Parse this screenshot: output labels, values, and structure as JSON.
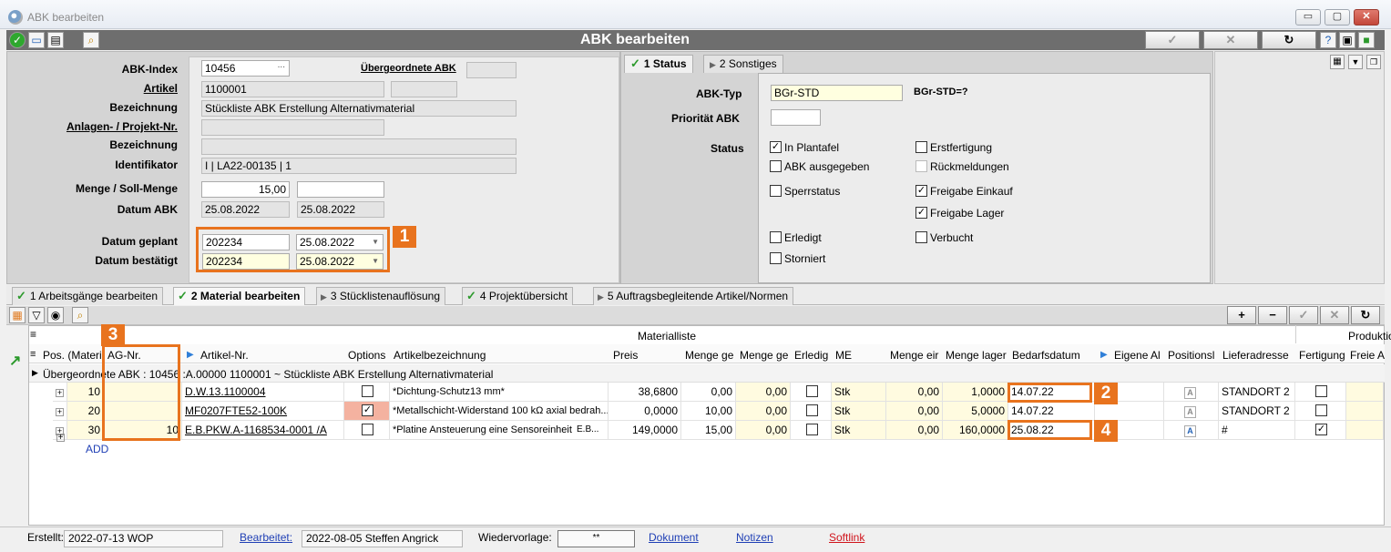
{
  "window": {
    "title": "ABK bearbeiten",
    "min": "▭",
    "max": "▢",
    "close": "✕"
  },
  "header": {
    "title": "ABK bearbeiten",
    "btn_ok": "✓",
    "btn_cancel": "✕",
    "btn_refresh": "↻"
  },
  "form": {
    "abk_index_label": "ABK-Index",
    "abk_index": "10456",
    "dots": "...",
    "uebergeordnete_label": "Übergeordnete ABK",
    "artikel_label": "Artikel",
    "artikel": "1100001",
    "bezeichnung_label": "Bezeichnung",
    "bezeichnung": "Stückliste ABK Erstellung Alternativmaterial",
    "anlagen_label": "Anlagen- / Projekt-Nr.",
    "bezeichnung2_label": "Bezeichnung",
    "identifikator_label": "Identifikator",
    "identifikator": "I | LA22-00135 | 1",
    "menge_label": "Menge / Soll-Menge",
    "menge": "15,00",
    "datum_abk_label": "Datum ABK",
    "datum_abk_1": "25.08.2022",
    "datum_abk_2": "25.08.2022",
    "datum_geplant_label": "Datum geplant",
    "datum_geplant_week": "202234",
    "datum_geplant": "25.08.2022",
    "datum_bestaetigt_label": "Datum bestätigt",
    "datum_bestaetigt_week": "202234",
    "datum_bestaetigt": "25.08.2022"
  },
  "badges": {
    "b1": "1",
    "b2": "2",
    "b3": "3",
    "b4": "4"
  },
  "status_tabs": {
    "tab1": "1 Status",
    "tab2": "2 Sonstiges"
  },
  "status": {
    "abk_typ_label": "ABK-Typ",
    "abk_typ": "BGr-STD",
    "abk_typ_note": "BGr-STD=?",
    "prioritaet_label": "Priorität ABK",
    "status_label": "Status",
    "in_plantafel": "In Plantafel",
    "erstfertigung": "Erstfertigung",
    "abk_ausgegeben": "ABK ausgegeben",
    "rueckmeldungen": "Rückmeldungen",
    "sperrstatus": "Sperrstatus",
    "freigabe_einkauf": "Freigabe Einkauf",
    "freigabe_lager": "Freigabe Lager",
    "erledigt": "Erledigt",
    "verbucht": "Verbucht",
    "storniert": "Storniert",
    "check": "✓"
  },
  "bottom_tabs": [
    "1 Arbeitsgänge bearbeiten",
    "2 Material bearbeiten",
    "3 Stücklistenauflösung",
    "4 Projektübersicht",
    "5 Auftragsbegleitende Artikel/Normen"
  ],
  "grid": {
    "group_title": "Materialliste",
    "group_title2": "Produktio",
    "columns": [
      "Pos. (Materi",
      "AG-Nr.",
      "Artikel-Nr.",
      "Options",
      "Artikelbezeichnung",
      "Preis",
      "Menge ge",
      "Menge ge",
      "Erledig",
      "ME",
      "Menge eir",
      "Menge lager",
      "Bedarfsdatum",
      "Eigene Al",
      "Positionsl",
      "Lieferadresse",
      "Fertigung",
      "Freie A"
    ],
    "parent_row": "Übergeordnete ABK :  10456 :A.00000 1100001 ~ Stückliste ABK Erstellung Alternativmaterial",
    "rows": [
      {
        "pos": "10",
        "ag": "",
        "artikel": "D.W.13.1100004",
        "bez": "*Dichtung-Schutz13 mm*",
        "bez2": "",
        "preis": "38,6800",
        "m1": "0,00",
        "m2": "0,00",
        "me": "Stk",
        "m3": "0,00",
        "lager": "1,0000",
        "datum": "14.07.22",
        "lief": "STANDORT 2"
      },
      {
        "pos": "20",
        "ag": "",
        "artikel": "MF0207FTE52-100K",
        "bez": "*Metallschicht-Widerstand 100 kΩ axial bedrah...",
        "bez2": "",
        "preis": "0,0000",
        "m1": "10,00",
        "m2": "0,00",
        "me": "Stk",
        "m3": "0,00",
        "lager": "5,0000",
        "datum": "14.07.22",
        "lief": "STANDORT 2"
      },
      {
        "pos": "30",
        "ag": "10",
        "artikel": "E.B.PKW.A-1168534-0001 /A",
        "bez": "*Platine Ansteuerung eine Sensoreinheit",
        "bez2": "E.B...",
        "preis": "149,0000",
        "m1": "15,00",
        "m2": "0,00",
        "me": "Stk",
        "m3": "0,00",
        "lager": "160,0000",
        "datum": "25.08.22",
        "lief": "#"
      }
    ],
    "add": "ADD"
  },
  "statusbar": {
    "erstellt_label": "Erstellt:",
    "erstellt": "2022-07-13  WOP",
    "bearbeitet_label": "Bearbeitet:",
    "bearbeitet": "2022-08-05  Steffen Angrick",
    "wiedervorlage_label": "Wiedervorlage:",
    "wiedervorlage": "**",
    "dokument": "Dokument",
    "notizen": "Notizen",
    "softlink": "Softlink"
  }
}
